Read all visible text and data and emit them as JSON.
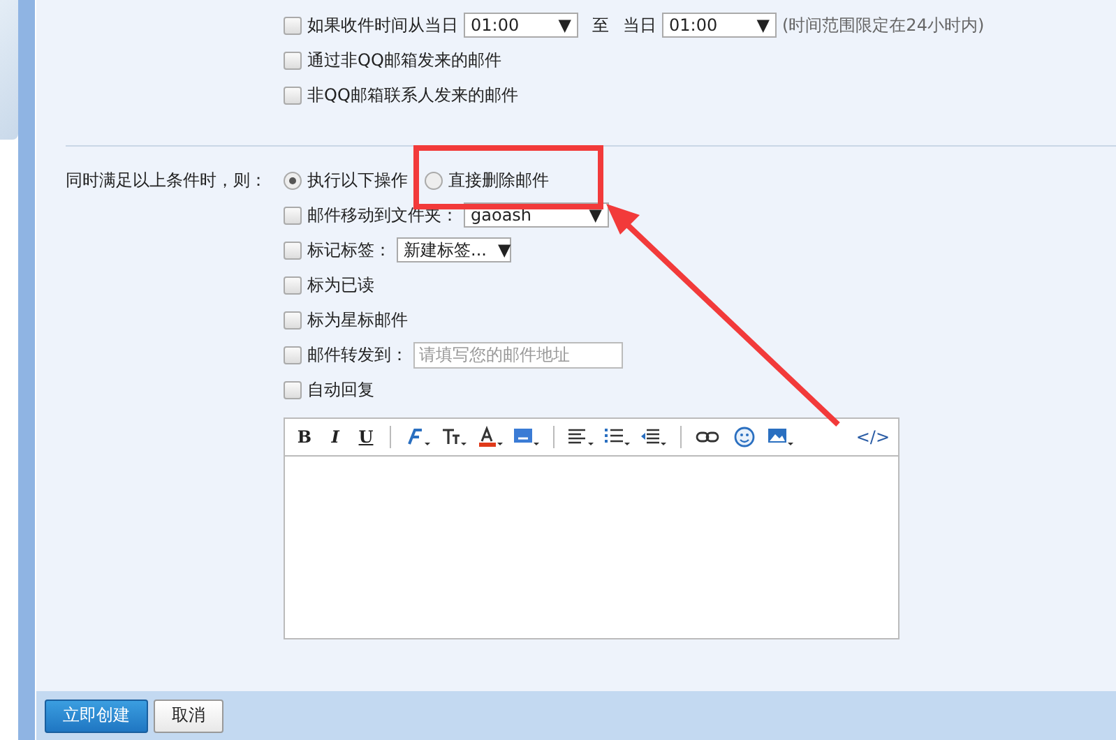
{
  "conditions": [
    {
      "kind": "time",
      "checked": false,
      "label": "如果收件时间从当日",
      "from": "01:00",
      "from_arrow": "▼",
      "to_label": "至",
      "day_label": "当日",
      "to": "01:00",
      "to_arrow": "▼",
      "note": "(时间范围限定在24小时内)"
    },
    {
      "kind": "plain",
      "checked": false,
      "label": "通过非QQ邮箱发来的邮件"
    },
    {
      "kind": "plain",
      "checked": false,
      "label": "非QQ邮箱联系人发来的邮件"
    }
  ],
  "action_label": "同时满足以上条件时，则：",
  "modes": [
    {
      "label": "执行以下操作",
      "selected": true
    },
    {
      "label": "直接删除邮件",
      "selected": false
    }
  ],
  "actions": [
    {
      "kind": "select",
      "checked": false,
      "label": "邮件移动到文件夹：",
      "value": "gaoash",
      "arrow": "▼"
    },
    {
      "kind": "select",
      "checked": false,
      "label": "标记标签：",
      "value": "新建标签...",
      "arrow": "▼"
    },
    {
      "kind": "plain",
      "checked": false,
      "label": "标为已读"
    },
    {
      "kind": "plain",
      "checked": false,
      "label": "标为星标邮件"
    },
    {
      "kind": "input",
      "checked": false,
      "label": "邮件转发到：",
      "placeholder": "请填写您的邮件地址"
    },
    {
      "kind": "plain",
      "checked": false,
      "label": "自动回复"
    }
  ],
  "toolbar": [
    {
      "kind": "text",
      "label": "B"
    },
    {
      "kind": "text",
      "label": "I"
    },
    {
      "kind": "text",
      "label": "U"
    },
    {
      "kind": "sep"
    },
    {
      "kind": "icon"
    },
    {
      "kind": "icon"
    },
    {
      "kind": "icon"
    },
    {
      "kind": "icon"
    },
    {
      "kind": "sep"
    },
    {
      "kind": "icon"
    },
    {
      "kind": "icon"
    },
    {
      "kind": "icon"
    },
    {
      "kind": "sep"
    },
    {
      "kind": "icon"
    },
    {
      "kind": "icon"
    },
    {
      "kind": "icon"
    },
    {
      "kind": "text",
      "label": "</>"
    }
  ],
  "buttons": [
    {
      "kind": "primary",
      "label": "立即创建"
    },
    {
      "kind": "secondary",
      "label": "取消"
    }
  ]
}
